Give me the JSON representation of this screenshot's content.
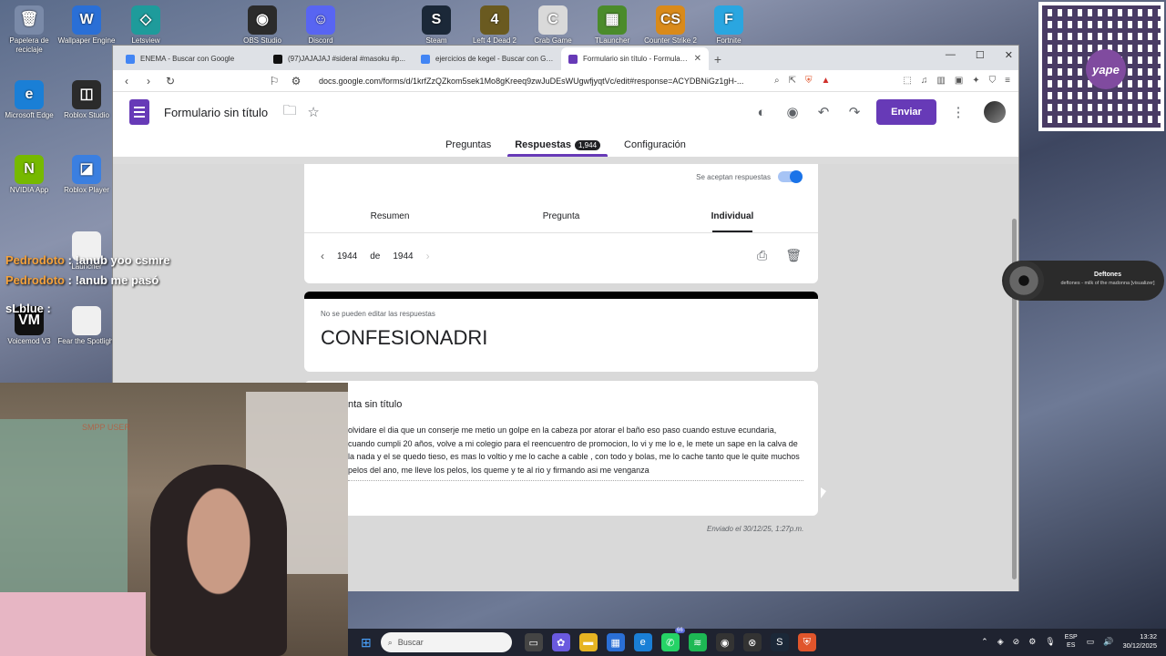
{
  "desktop": {
    "icons": [
      {
        "label": "Papelera de reciclaje",
        "color": "#7a8aa8",
        "glyph": "🗑"
      },
      {
        "label": "Wallpaper Engine",
        "color": "#2a6fd6",
        "glyph": "W"
      },
      {
        "label": "Letsview",
        "color": "#1e9b9b",
        "glyph": "◇"
      },
      {
        "label": "OBS Studio",
        "color": "#2b2b2b",
        "glyph": "◉"
      },
      {
        "label": "Discord",
        "color": "#5865f2",
        "glyph": "☺"
      },
      {
        "label": "Steam",
        "color": "#1b2838",
        "glyph": "S"
      },
      {
        "label": "Left 4 Dead 2",
        "color": "#6a5a20",
        "glyph": "4"
      },
      {
        "label": "Crab Game",
        "color": "#d9d9d9",
        "glyph": "C"
      },
      {
        "label": "TLauncher",
        "color": "#4b8b2b",
        "glyph": "▦"
      },
      {
        "label": "Counter Strike 2",
        "color": "#d98a1a",
        "glyph": "CS"
      },
      {
        "label": "Fortnite",
        "color": "#2aa6e0",
        "glyph": "F"
      },
      {
        "label": "Microsoft Edge",
        "color": "#1a7fd6",
        "glyph": "e"
      },
      {
        "label": "Roblox Studio",
        "color": "#2b2b2b",
        "glyph": "◫"
      },
      {
        "label": "NVIDIA App",
        "color": "#76b900",
        "glyph": "N"
      },
      {
        "label": "Roblox Player",
        "color": "#3b7fe0",
        "glyph": "◪"
      },
      {
        "label": "Launcher",
        "color": "#f0f0f0",
        "glyph": ""
      },
      {
        "label": "Voicemod V3",
        "color": "#111111",
        "glyph": "VM"
      },
      {
        "label": "Fear the Spotlight",
        "color": "#f0f0f0",
        "glyph": ""
      }
    ]
  },
  "chat": {
    "lines": [
      {
        "name": "Pedrodoto",
        "text": ": !anub yoo csmre"
      },
      {
        "name": "Pedrodoto",
        "text": ": !anub me pasó"
      }
    ],
    "third": "sLblue :"
  },
  "webcam": {
    "overlay_text": "SMPP USER"
  },
  "qr": {
    "brand": "yape"
  },
  "browser": {
    "tabs": [
      {
        "label": "ENEMA - Buscar con Google",
        "fav": "#4285f4"
      },
      {
        "label": "(97)JAJAJAJ #sideral #masoku #p...",
        "fav": "#111111"
      },
      {
        "label": "ejercicios de kegel - Buscar con Goo...",
        "fav": "#4285f4"
      },
      {
        "label": "Formulario sin título - Formularios",
        "fav": "#673ab7"
      }
    ],
    "new_tab": "+",
    "url": "docs.google.com/forms/d/1krfZzQZkom5sek1Mo8gKreeq9zwJuDEsWUgwfjyqtVc/edit#response=ACYDBNiGz1gH-..."
  },
  "form": {
    "title": "Formulario sin título",
    "send_label": "Enviar",
    "tabs": {
      "questions": "Preguntas",
      "responses": "Respuestas",
      "responses_count": "1,944",
      "settings": "Configuración"
    },
    "accepting": "Se aceptan respuestas",
    "subtabs": [
      "Resumen",
      "Pregunta",
      "Individual"
    ],
    "pager": {
      "current": "1944",
      "of": "de",
      "total": "1944"
    },
    "no_edit": "No se pueden editar las respuestas",
    "response_title": "CONFESIONADRI",
    "question": "nta sin título",
    "answer": "olvidare el dia que un conserje me metio un golpe en la cabeza por atorar el baño eso paso cuando estuve ecundaria, cuando cumpli 20 años, volve a mi colegio para el reencuentro de promocion, lo vi y me lo e, le mete un sape en la calva de la nada y el se quedo tieso, es mas lo voltio y me lo cache a cable , con todo y bolas, me lo cache tanto que le quite muchos pelos del ano, me lleve los pelos, los queme y te al rio y firmando asi me venganza",
    "sent": "Enviado el 30/12/25, 1:27p.m."
  },
  "now_playing": {
    "artist": "Deftones",
    "song": "deftones - milk of the madonna [visualizer]"
  },
  "taskbar": {
    "search_placeholder": "Buscar",
    "lang_top": "ESP",
    "lang_bottom": "ES",
    "time": "13:32",
    "date": "30/12/2025",
    "badge": "66"
  }
}
